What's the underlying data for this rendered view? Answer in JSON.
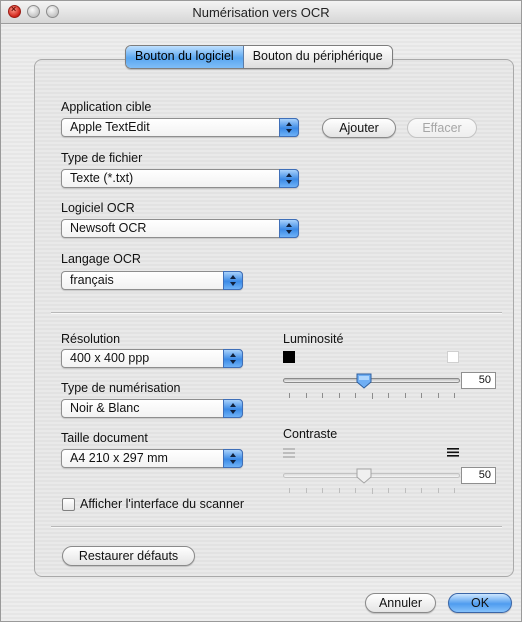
{
  "window": {
    "title": "Numérisation vers OCR"
  },
  "tabs": [
    {
      "label": "Bouton du logiciel"
    },
    {
      "label": "Bouton du périphérique"
    }
  ],
  "fields": {
    "application_cible": {
      "label": "Application cible",
      "value": "Apple TextEdit"
    },
    "type_fichier": {
      "label": "Type de fichier",
      "value": "Texte (*.txt)"
    },
    "logiciel_ocr": {
      "label": "Logiciel OCR",
      "value": "Newsoft OCR"
    },
    "langage_ocr": {
      "label": "Langage OCR",
      "value": "français"
    },
    "resolution": {
      "label": "Résolution",
      "value": "400 x 400 ppp"
    },
    "type_numerisation": {
      "label": "Type de numérisation",
      "value": "Noir & Blanc"
    },
    "taille_document": {
      "label": "Taille document",
      "value": "A4  210 x 297 mm"
    }
  },
  "buttons": {
    "ajouter": "Ajouter",
    "effacer": "Effacer",
    "restaurer": "Restaurer défauts",
    "annuler": "Annuler",
    "ok": "OK"
  },
  "luminosite": {
    "label": "Luminosité",
    "value": "50",
    "fraction": 0.5
  },
  "contraste": {
    "label": "Contraste",
    "value": "50",
    "fraction": 0.5,
    "enabled": false
  },
  "checkbox": {
    "label": "Afficher l'interface du scanner",
    "checked": false
  },
  "colors": {
    "accent": "#4f9cef"
  }
}
